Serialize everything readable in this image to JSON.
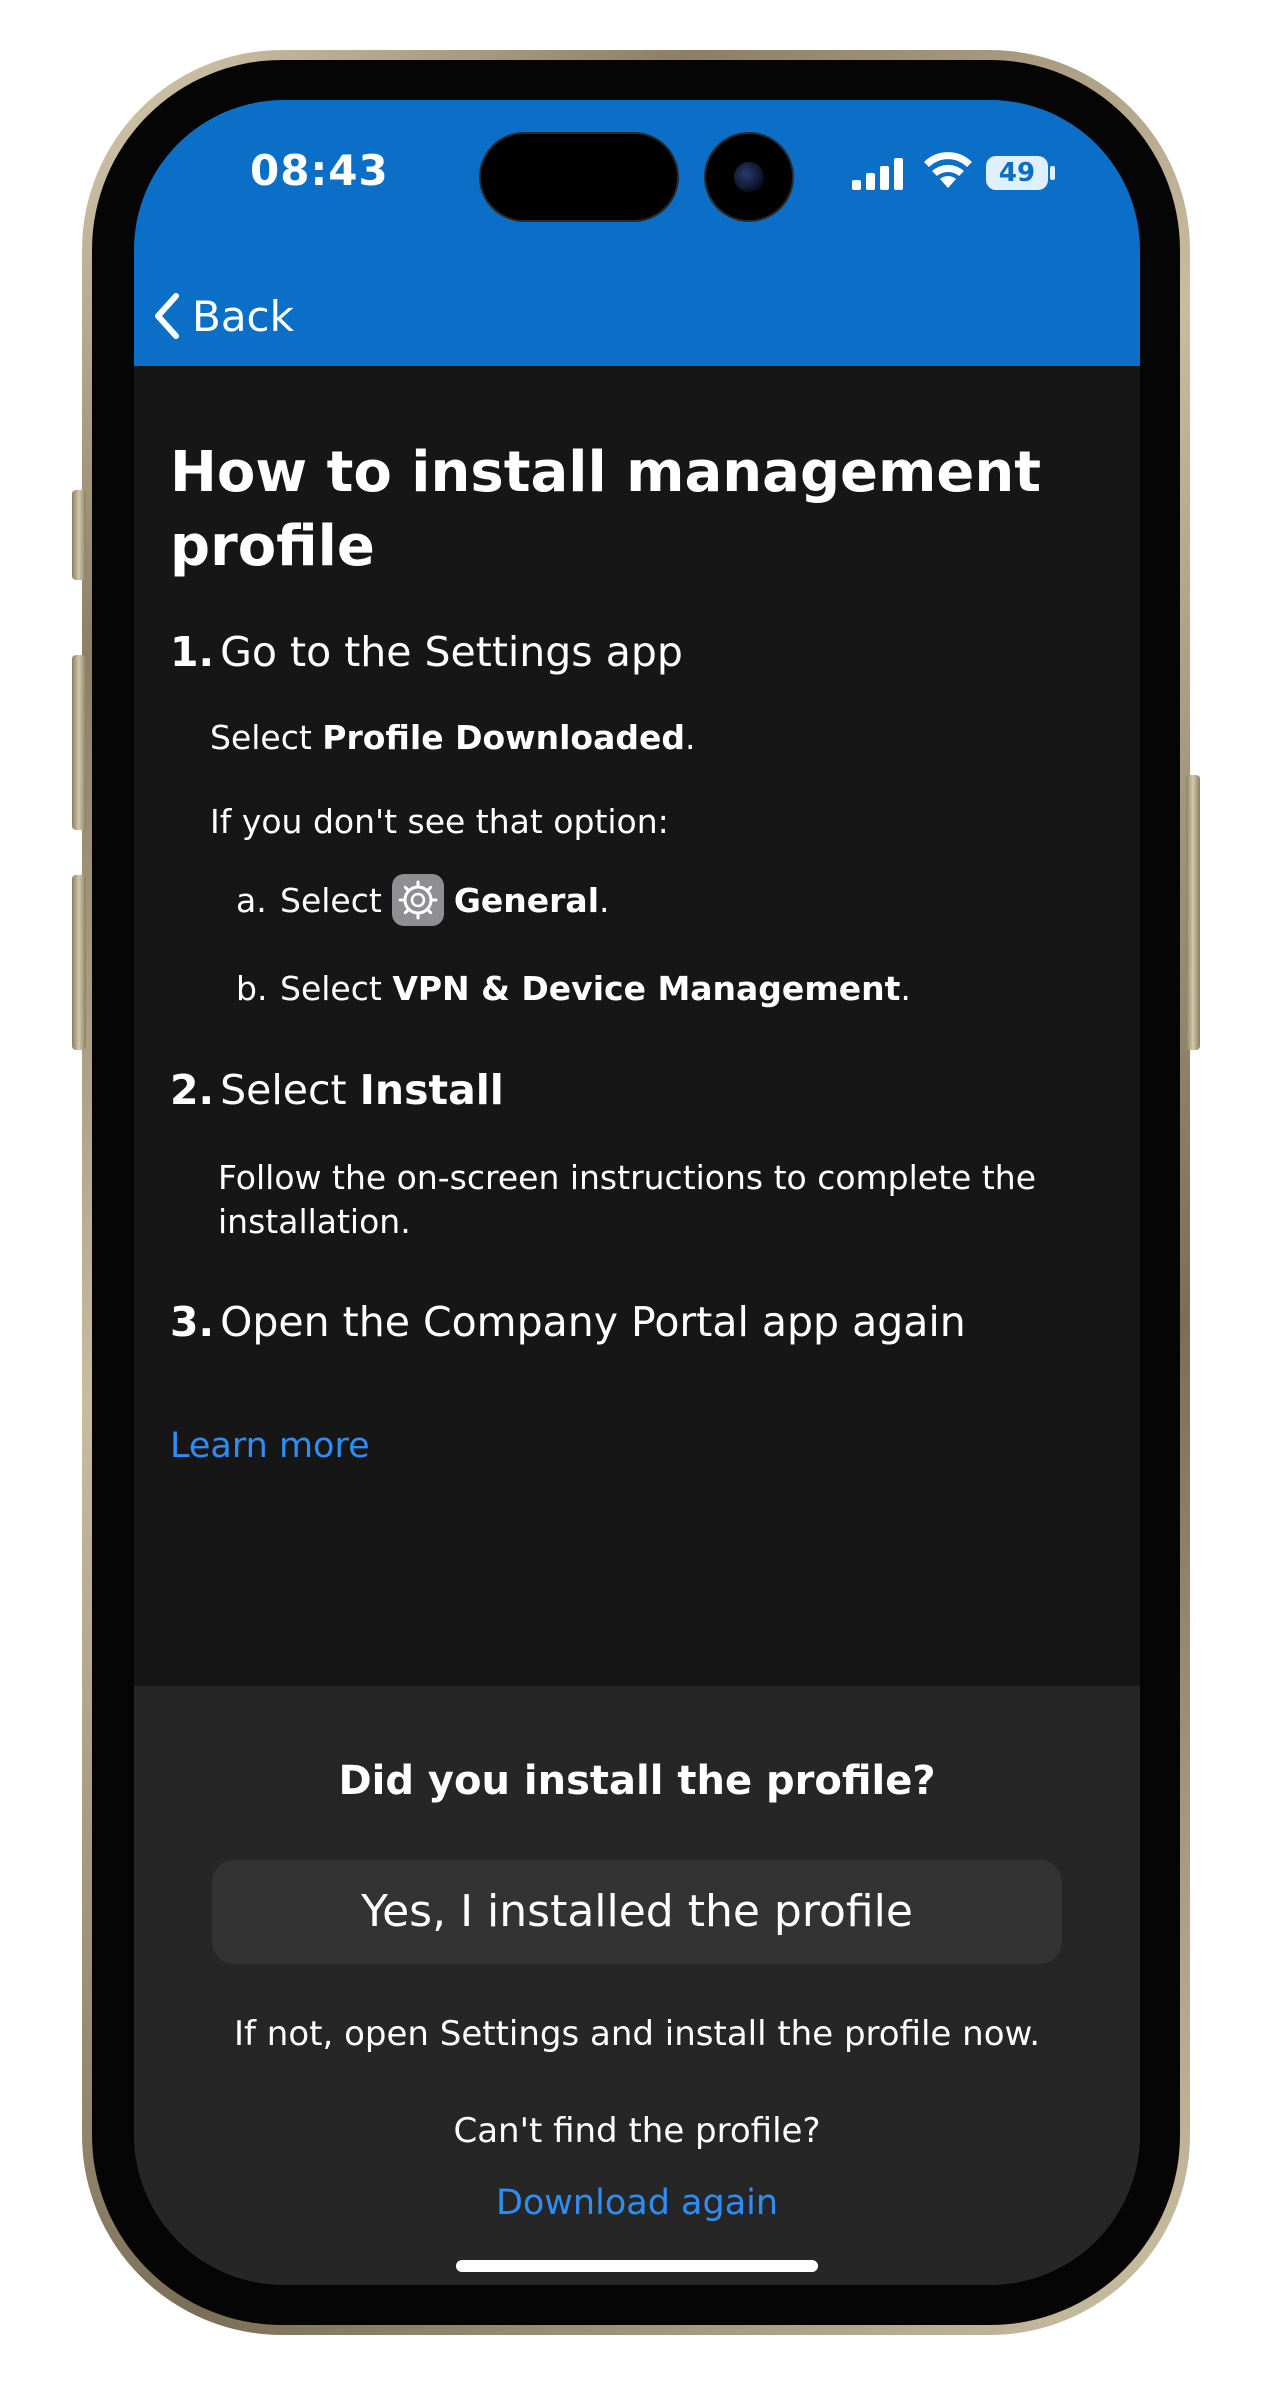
{
  "status_bar": {
    "time": "08:43",
    "battery": "49"
  },
  "nav": {
    "back_label": "Back"
  },
  "page": {
    "title": "How to install management profile",
    "steps": [
      {
        "number": "1.",
        "heading": "Go to the Settings app"
      },
      {
        "number": "2.",
        "heading_prefix": "Select ",
        "heading_bold": "Install"
      },
      {
        "number": "3.",
        "heading": "Open the Company Portal app again"
      }
    ],
    "step1": {
      "select_prefix": "Select ",
      "select_bold": "Profile Downloaded",
      "select_suffix": ".",
      "fallback": "If you don't see that option:",
      "sub_a": {
        "letter": "a.",
        "prefix": "Select ",
        "bold": "General",
        "suffix": "."
      },
      "sub_b": {
        "letter": "b.",
        "prefix": "Select ",
        "bold": "VPN & Device Management",
        "suffix": "."
      }
    },
    "step2_text": "Follow the on-screen instructions to complete the installation.",
    "learn_more": "Learn more"
  },
  "bottom": {
    "question": "Did you install the profile?",
    "yes_button": "Yes, I installed the profile",
    "if_not": "If not, open Settings and install the profile now.",
    "cant_find": "Can't find the profile?",
    "download_again": "Download again"
  },
  "colors": {
    "accent": "#0b6fc8",
    "link": "#2f8ef5",
    "background": "#161616",
    "panel": "#262626"
  },
  "icons": [
    "chevron-left-icon",
    "signal-icon",
    "wifi-icon",
    "battery-icon",
    "gear-icon"
  ]
}
